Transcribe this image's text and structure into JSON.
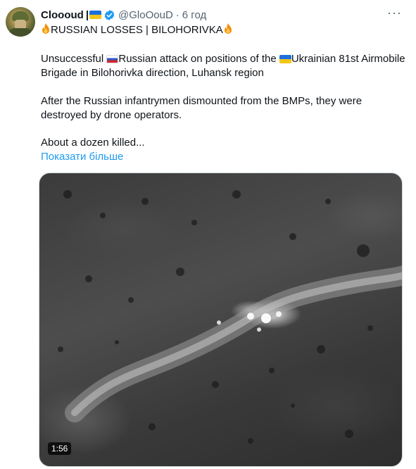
{
  "tweet": {
    "author_name": "Cloooud",
    "author_flag_icon": "ukraine-flag-icon",
    "pipe": "|",
    "handle": "@GloOouD",
    "separator": "·",
    "time": "6 год",
    "more_icon": "more-dots-icon",
    "headline": "RUSSIAN LOSSES | BILOHORIVKA",
    "line1_part1": "Unsuccessful ",
    "line1_part2": "Russian attack on positions of the ",
    "line1_part3": "Ukrainian 81st Airmobile",
    "line2": "Brigade in Bilohorivka direction, Luhansk region",
    "line3": "After the Russian infantrymen dismounted from the BMPs, they were",
    "line4": "destroyed by drone operators.",
    "line5": "About a dozen killed...",
    "show_more": "Показати більше"
  },
  "media": {
    "type": "video",
    "description_icon": "thermal-drone-footage",
    "duration": "1:56"
  },
  "colors": {
    "text": "#0f1419",
    "secondary": "#536471",
    "link": "#1d9bf0",
    "verified": "#1d9bf0"
  }
}
